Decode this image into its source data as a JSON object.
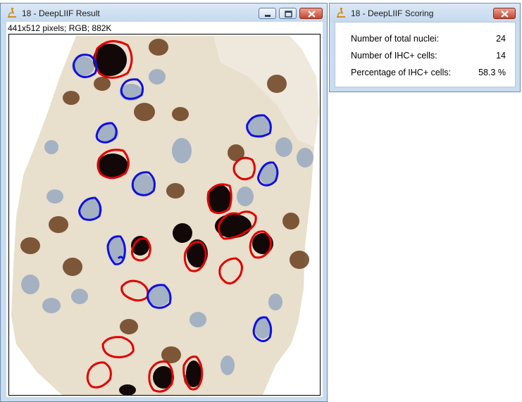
{
  "result_window": {
    "title": "18 - DeepLIIF Result",
    "image_info": "441x512 pixels; RGB; 882K"
  },
  "scoring_window": {
    "title": "18 - DeepLIIF Scoring",
    "rows": [
      {
        "label": "Number of total nuclei:",
        "value": "24"
      },
      {
        "label": "Number of IHC+ cells:",
        "value": "14"
      },
      {
        "label": "Percentage of IHC+ cells:",
        "value": "58.3 %"
      }
    ]
  },
  "colors": {
    "positive_outline": "#e00000",
    "negative_outline": "#1010e0",
    "tissue": "#e6dcc8"
  }
}
